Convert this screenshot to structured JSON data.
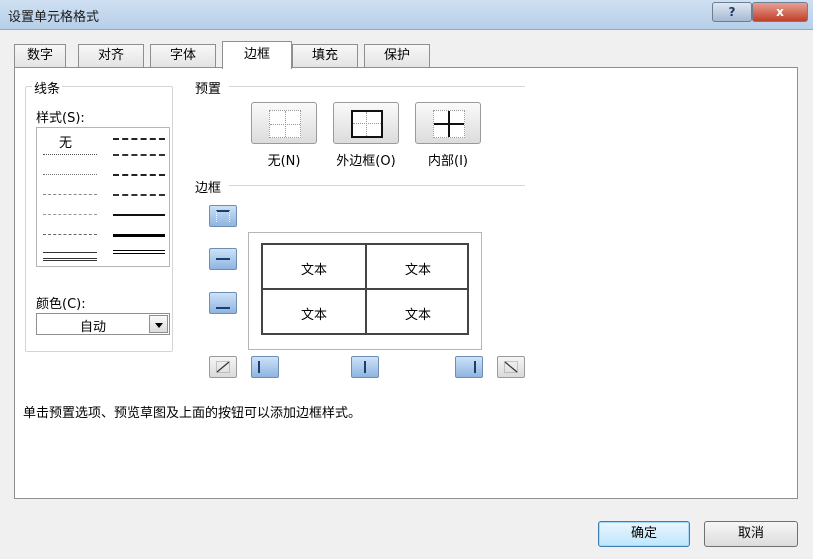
{
  "window": {
    "title": "设置单元格格式",
    "help_label": "?",
    "close_label": "x"
  },
  "tabs": [
    {
      "label": "数字",
      "active": false
    },
    {
      "label": "对齐",
      "active": false
    },
    {
      "label": "字体",
      "active": false
    },
    {
      "label": "边框",
      "active": true
    },
    {
      "label": "填充",
      "active": false
    },
    {
      "label": "保护",
      "active": false
    }
  ],
  "line": {
    "group_title": "线条",
    "style_label": "样式(S):",
    "none_label": "无",
    "color_label": "颜色(C):",
    "color_value": "自动"
  },
  "presets": {
    "title": "预置",
    "none_label": "无(N)",
    "outline_label": "外边框(O)",
    "inside_label": "内部(I)"
  },
  "border": {
    "title": "边框",
    "preview_cells": [
      "文本",
      "文本",
      "文本",
      "文本"
    ]
  },
  "hint": "单击预置选项、预览草图及上面的按钮可以添加边框样式。",
  "buttons": {
    "ok_label": "确定",
    "cancel_label": "取消"
  },
  "colors": {
    "accent": "#3c7fb1",
    "border_button": "#8fb4e0"
  }
}
